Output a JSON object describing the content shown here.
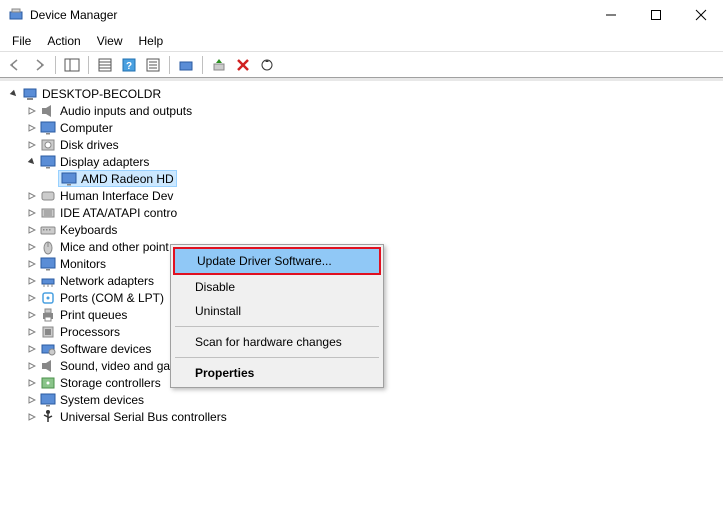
{
  "title": "Device Manager",
  "menu": {
    "file": "File",
    "action": "Action",
    "view": "View",
    "help": "Help"
  },
  "root": {
    "label": "DESKTOP-BECOLDR"
  },
  "nodes": [
    {
      "label": "Audio inputs and outputs",
      "icon": "speaker",
      "expanded": false,
      "indent": 1
    },
    {
      "label": "Computer",
      "icon": "monitor",
      "expanded": false,
      "indent": 1
    },
    {
      "label": "Disk drives",
      "icon": "disk",
      "expanded": false,
      "indent": 1
    },
    {
      "label": "Display adapters",
      "icon": "monitor",
      "expanded": true,
      "indent": 1
    }
  ],
  "selected_device": {
    "label": "AMD Radeon HD",
    "icon": "monitor"
  },
  "nodes_after": [
    {
      "label": "Human Interface Dev",
      "icon": "hid",
      "indent": 1
    },
    {
      "label": "IDE ATA/ATAPI contro",
      "icon": "ide",
      "indent": 1
    },
    {
      "label": "Keyboards",
      "icon": "keyboard",
      "indent": 1
    },
    {
      "label": "Mice and other point",
      "icon": "mouse",
      "indent": 1
    },
    {
      "label": "Monitors",
      "icon": "monitor",
      "indent": 1
    },
    {
      "label": "Network adapters",
      "icon": "network",
      "indent": 1
    },
    {
      "label": "Ports (COM & LPT)",
      "icon": "port",
      "indent": 1
    },
    {
      "label": "Print queues",
      "icon": "printer",
      "indent": 1
    },
    {
      "label": "Processors",
      "icon": "cpu",
      "indent": 1
    },
    {
      "label": "Software devices",
      "icon": "software",
      "indent": 1
    },
    {
      "label": "Sound, video and game controllers",
      "icon": "speaker",
      "indent": 1
    },
    {
      "label": "Storage controllers",
      "icon": "storage",
      "indent": 1
    },
    {
      "label": "System devices",
      "icon": "monitor",
      "indent": 1
    },
    {
      "label": "Universal Serial Bus controllers",
      "icon": "usb",
      "indent": 1
    }
  ],
  "ctx": {
    "update": "Update Driver Software...",
    "disable": "Disable",
    "uninstall": "Uninstall",
    "scan": "Scan for hardware changes",
    "properties": "Properties"
  }
}
